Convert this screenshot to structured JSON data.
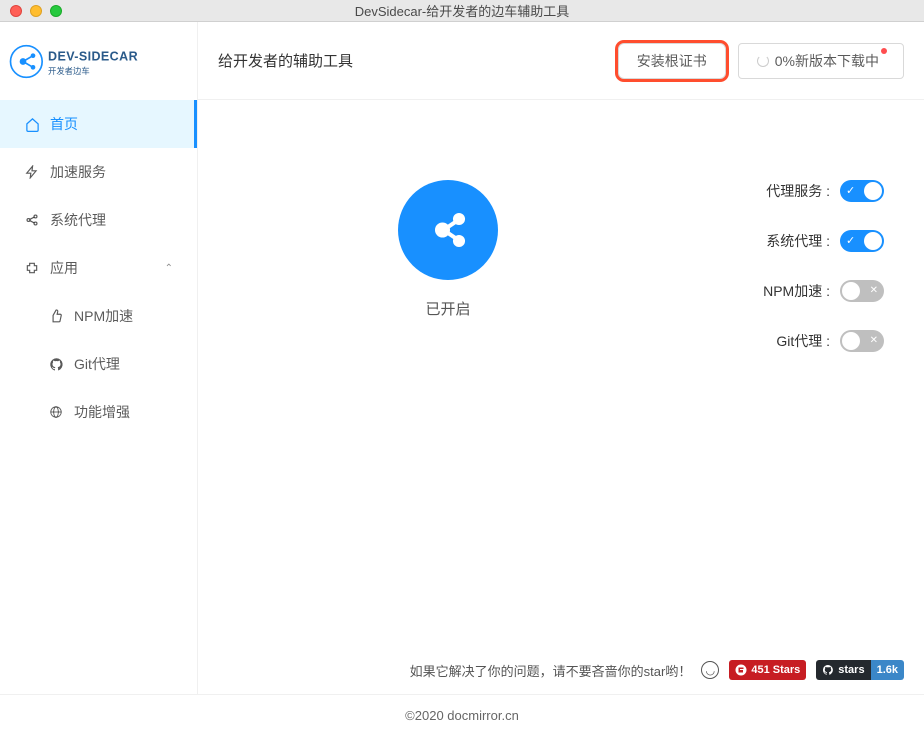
{
  "window": {
    "title": "DevSidecar-给开发者的边车辅助工具"
  },
  "logo": {
    "brand_top": "DEV-SIDECAR",
    "brand_sub": "开发者边车"
  },
  "sidebar": {
    "items": [
      {
        "label": "首页"
      },
      {
        "label": "加速服务"
      },
      {
        "label": "系统代理"
      },
      {
        "label": "应用"
      }
    ],
    "sub": [
      {
        "label": "NPM加速"
      },
      {
        "label": "Git代理"
      },
      {
        "label": "功能增强"
      }
    ]
  },
  "header": {
    "title": "给开发者的辅助工具",
    "install_cert": "安装根证书",
    "download": "0%新版本下载中"
  },
  "status": {
    "label": "已开启"
  },
  "toggles": {
    "proxy_service": {
      "label": "代理服务 :",
      "on": true
    },
    "system_proxy": {
      "label": "系统代理 :",
      "on": true
    },
    "npm_accel": {
      "label": "NPM加速 :",
      "on": false
    },
    "git_proxy": {
      "label": "Git代理 :",
      "on": false
    }
  },
  "footer": {
    "message": "如果它解决了你的问题，请不要吝啬你的star哟！",
    "gitee_stars": "451 Stars",
    "github_label": "stars",
    "github_stars": "1.6k",
    "copyright": "©2020 docmirror.cn"
  }
}
